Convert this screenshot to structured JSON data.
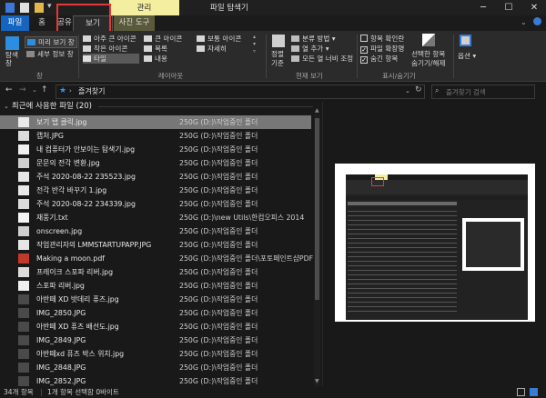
{
  "window": {
    "title": "파일 탐색기",
    "context_tab": "관리"
  },
  "tabs": [
    "파일",
    "홈",
    "공유",
    "보기",
    "사진 도구"
  ],
  "ribbon": {
    "panes": {
      "nav_pane": "탐색 창",
      "preview_pane": "미리 보기 창",
      "details_pane": "세부 정보 창",
      "group": "창"
    },
    "layout": {
      "items": [
        "아주 큰 아이콘",
        "큰 아이콘",
        "보통 아이콘",
        "작은 아이콘",
        "목록",
        "자세히",
        "타일",
        "내용"
      ],
      "group": "레이아웃"
    },
    "current_view": {
      "sort_label": "정렬",
      "sort_label2": "기준",
      "group_by": "분류 방법",
      "add_columns": "열 추가",
      "fit_columns": "모든 열 너비 조정",
      "group": "현재 보기"
    },
    "show_hide": {
      "item_checkboxes": "항목 확인란",
      "file_extensions": "파일 확장명",
      "hidden_items": "숨긴 항목",
      "hide_selected_1": "선택한 항목",
      "hide_selected_2": "숨기기/해제",
      "group": "표시/숨기기"
    },
    "options": "옵션"
  },
  "address": {
    "location": "즐겨찾기",
    "search_placeholder": "즐겨찾기 검색"
  },
  "list": {
    "header": "최근에 사용한 파일 (20)",
    "rows": [
      {
        "name": "보기 탭 클릭.jpg",
        "location": "250G (D:)\\작업중인 폴더",
        "selected": true
      },
      {
        "name": "캡처.JPG",
        "location": "250G (D:)\\작업중인 폴더"
      },
      {
        "name": "내 컴퓨터가 안보이는 탐색기.jpg",
        "location": "250G (D:)\\작업중인 폴더"
      },
      {
        "name": "문문의 전각 변환.jpg",
        "location": "250G (D:)\\작업중인 폴더"
      },
      {
        "name": "주석 2020-08-22 235523.jpg",
        "location": "250G (D:)\\작업중인 폴더"
      },
      {
        "name": "전각 반각 바꾸기 1.jpg",
        "location": "250G (D:)\\작업중인 폴더"
      },
      {
        "name": "주석 2020-08-22 234339.jpg",
        "location": "250G (D:)\\작업중인 폴더"
      },
      {
        "name": "재풍기.txt",
        "location": "250G (D:)\\new Utils\\한컴오피스 2014"
      },
      {
        "name": "onscreen.jpg",
        "location": "250G (D:)\\작업중인 폴더"
      },
      {
        "name": "작업관리자의 LMMSTARTUPAPP.JPG",
        "location": "250G (D:)\\작업중인 폴더"
      },
      {
        "name": "Making a moon.pdf",
        "location": "250G (D:)\\작업중인 폴더\\포토페인트샵PDF"
      },
      {
        "name": "프레이크 스포파 리버.jpg",
        "location": "250G (D:)\\작업중인 폴더"
      },
      {
        "name": "스포파 리버.jpg",
        "location": "250G (D:)\\작업중인 폴더"
      },
      {
        "name": "아반떼 XD 밧데리 퓨즈.jpg",
        "location": "250G (D:)\\작업중인 폴더"
      },
      {
        "name": "IMG_2850.JPG",
        "location": "250G (D:)\\작업중인 폴더"
      },
      {
        "name": "아반떼 XD 퓨즈 배선도.jpg",
        "location": "250G (D:)\\작업중인 폴더"
      },
      {
        "name": "IMG_2849.JPG",
        "location": "250G (D:)\\작업중인 폴더"
      },
      {
        "name": "아반떼xd 퓨즈 박스 위치.jpg",
        "location": "250G (D:)\\작업중인 폴더"
      },
      {
        "name": "IMG_2848.JPG",
        "location": "250G (D:)\\작업중인 폴더"
      },
      {
        "name": "IMG_2852.JPG",
        "location": "250G (D:)\\작업중인 폴더"
      }
    ]
  },
  "status": {
    "count": "34개 항목",
    "selected": "1개 항목 선택함 0바이트"
  },
  "colors": {
    "accent": "#1565c0",
    "context_tab": "#f4eea0",
    "highlight_box": "#e53935"
  }
}
